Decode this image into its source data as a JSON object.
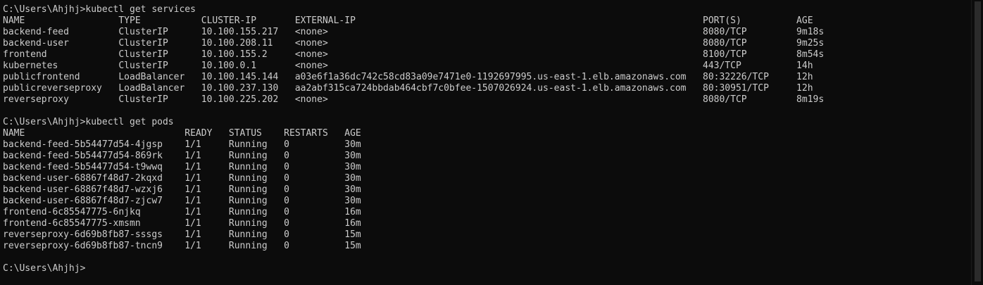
{
  "terminal": {
    "prompt": "C:\\Users\\Ahjhj>",
    "lines": [
      "C:\\Users\\Ahjhj>kubectl get services",
      "NAME                 TYPE           CLUSTER-IP       EXTERNAL-IP                                                               PORT(S)          AGE",
      "backend-feed         ClusterIP      10.100.155.217   <none>                                                                    8080/TCP         9m18s",
      "backend-user         ClusterIP      10.100.208.11    <none>                                                                    8080/TCP         9m25s",
      "frontend             ClusterIP      10.100.155.2     <none>                                                                    8100/TCP         8m54s",
      "kubernetes           ClusterIP      10.100.0.1       <none>                                                                    443/TCP          14h",
      "publicfrontend       LoadBalancer   10.100.145.144   a03e6f1a36dc742c58cd83a09e7471e0-1192697995.us-east-1.elb.amazonaws.com   80:32226/TCP     12h",
      "publicreverseproxy   LoadBalancer   10.100.237.130   aa2abf315ca724bbdab464cbf7c0bfee-1507026924.us-east-1.elb.amazonaws.com   80:30951/TCP     12h",
      "reverseproxy         ClusterIP      10.100.225.202   <none>                                                                    8080/TCP         8m19s",
      "",
      "C:\\Users\\Ahjhj>kubectl get pods",
      "NAME                             READY   STATUS    RESTARTS   AGE",
      "backend-feed-5b54477d54-4jgsp    1/1     Running   0          30m",
      "backend-feed-5b54477d54-869rk    1/1     Running   0          30m",
      "backend-feed-5b54477d54-t9wwq    1/1     Running   0          30m",
      "backend-user-68867f48d7-2kqxd    1/1     Running   0          30m",
      "backend-user-68867f48d7-wzxj6    1/1     Running   0          30m",
      "backend-user-68867f48d7-zjcw7    1/1     Running   0          30m",
      "frontend-6c85547775-6njkq        1/1     Running   0          16m",
      "frontend-6c85547775-xmsmn        1/1     Running   0          16m",
      "reverseproxy-6d69b8fb87-sssgs    1/1     Running   0          15m",
      "reverseproxy-6d69b8fb87-tncn9    1/1     Running   0          15m",
      "",
      "C:\\Users\\Ahjhj>"
    ]
  },
  "colors": {
    "background": "#0c0c0c",
    "text": "#cccccc",
    "scrollbar_thumb": "#2b2b2b"
  }
}
